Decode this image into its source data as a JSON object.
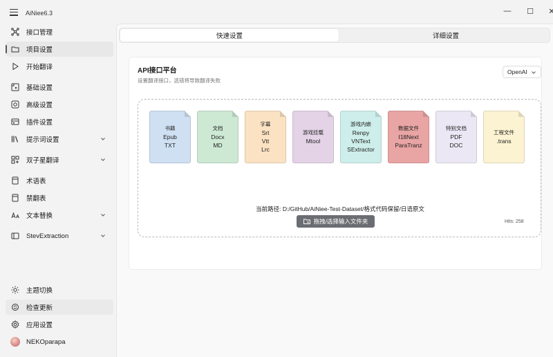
{
  "window": {
    "title": "AiNiee6.3",
    "minimize": "—",
    "maximize": "☐",
    "close": "✕"
  },
  "sidebar": {
    "items": [
      {
        "label": "接口管理",
        "icon": "network-icon"
      },
      {
        "label": "项目设置",
        "icon": "folder-icon",
        "active": true
      },
      {
        "label": "开始翻译",
        "icon": "play-icon"
      },
      {
        "label": "基础设置",
        "icon": "basic-settings-icon"
      },
      {
        "label": "高级设置",
        "icon": "advanced-settings-icon"
      },
      {
        "label": "插件设置",
        "icon": "plugin-icon"
      },
      {
        "label": "提示词设置",
        "icon": "library-icon",
        "expandable": true
      },
      {
        "label": "双子星翻译",
        "icon": "grid-icon",
        "expandable": true
      },
      {
        "label": "术语表",
        "icon": "book-icon"
      },
      {
        "label": "禁翻表",
        "icon": "book-icon"
      },
      {
        "label": "文本替换",
        "icon": "text-replace-icon",
        "expandable": true
      },
      {
        "label": "StevExtraction",
        "icon": "extraction-icon",
        "expandable": true
      }
    ],
    "bottom": [
      {
        "label": "主题切换",
        "icon": "sun-icon"
      },
      {
        "label": "检查更新",
        "icon": "sync-icon"
      },
      {
        "label": "应用设置",
        "icon": "gear-icon"
      },
      {
        "label": "NEKOparapa",
        "icon": "avatar"
      }
    ]
  },
  "tabs": {
    "quick": "快速设置",
    "detail": "详细设置"
  },
  "api": {
    "title": "API接口平台",
    "subtitle": "设置翻译接口，选错将导致翻译失败",
    "selected": "OpenAI"
  },
  "files": [
    {
      "lines": [
        "书籍",
        "Epub",
        "TXT"
      ],
      "color": "#cfe0f3"
    },
    {
      "lines": [
        "文档",
        "Docx",
        "MD"
      ],
      "color": "#cde9d4"
    },
    {
      "lines": [
        "字幕",
        "Srt",
        "Vtt",
        "Lrc"
      ],
      "color": "#fbe2c2"
    },
    {
      "lines": [
        "游戏挂载",
        "Mtool"
      ],
      "color": "#e4d3e7"
    },
    {
      "lines": [
        "游戏内嵌",
        "Renpy",
        "VNText",
        "SExtractor"
      ],
      "color": "#cdeeea"
    },
    {
      "lines": [
        "数据文件",
        "I18Next",
        "ParaTranz"
      ],
      "color": "#e9a4a4"
    },
    {
      "lines": [
        "特别文档",
        "PDF",
        "DOC"
      ],
      "color": "#ebe7f4"
    },
    {
      "lines": [
        "工程文件",
        ".trans"
      ],
      "color": "#fcf3d2"
    }
  ],
  "path": {
    "text": "当前路径: D:/GitHub/AiNiee-Test-Dataset/格式代码保留/日语原文"
  },
  "drag_button": "拖拽/选择输入文件夹",
  "hits": "Hits: 258"
}
